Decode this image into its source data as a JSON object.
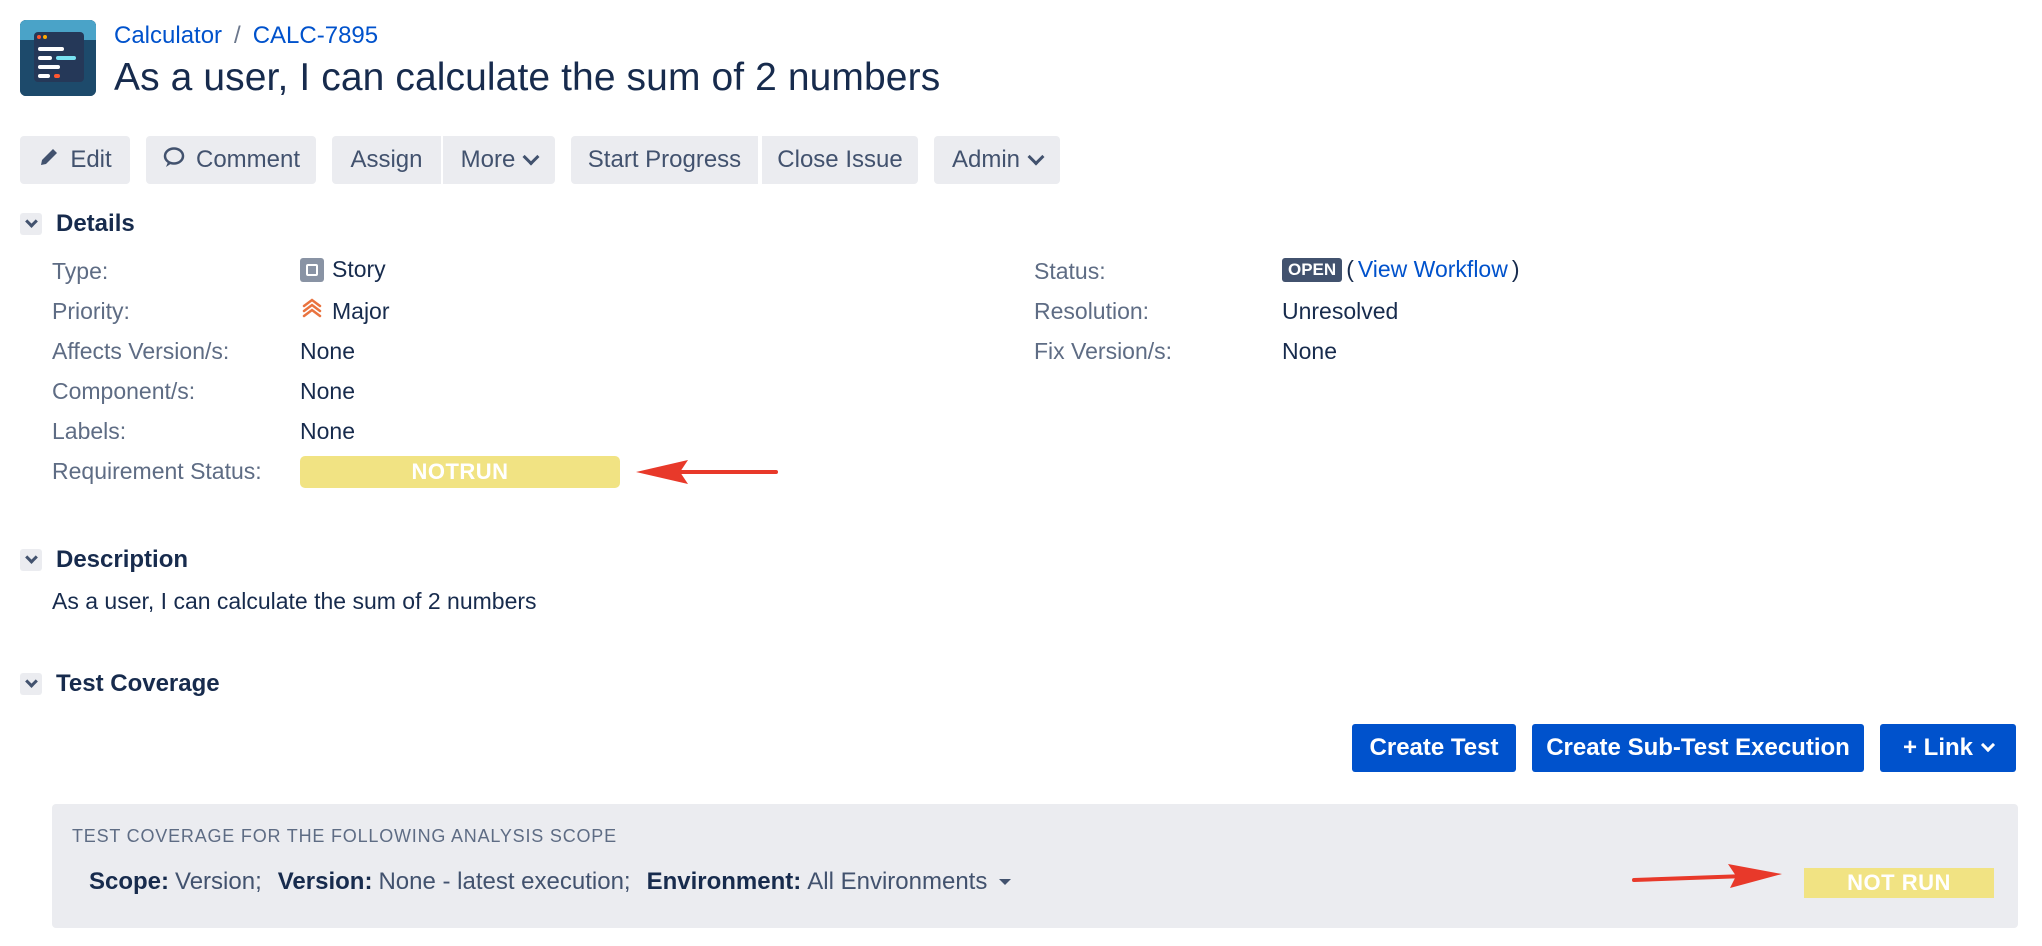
{
  "breadcrumb": {
    "project": "Calculator",
    "issue_key": "CALC-7895"
  },
  "issue": {
    "title": "As a user, I can calculate the sum of 2 numbers"
  },
  "toolbar": {
    "edit": "Edit",
    "comment": "Comment",
    "assign": "Assign",
    "more": "More",
    "start_progress": "Start Progress",
    "close_issue": "Close Issue",
    "admin": "Admin"
  },
  "details": {
    "heading": "Details",
    "type_label": "Type:",
    "type_value": "Story",
    "priority_label": "Priority:",
    "priority_value": "Major",
    "affects_label": "Affects Version/s:",
    "affects_value": "None",
    "components_label": "Component/s:",
    "components_value": "None",
    "labels_label": "Labels:",
    "labels_value": "None",
    "req_status_label": "Requirement Status:",
    "req_status_value": "NOTRUN",
    "status_label": "Status:",
    "status_value": "OPEN",
    "view_workflow": "View Workflow",
    "paren_open": "(",
    "paren_close": ")",
    "resolution_label": "Resolution:",
    "resolution_value": "Unresolved",
    "fix_label": "Fix Version/s:",
    "fix_value": "None"
  },
  "description": {
    "heading": "Description",
    "text": "As a user, I can calculate the sum of 2 numbers"
  },
  "test_coverage": {
    "heading": "Test Coverage",
    "create_test": "Create Test",
    "create_sub_test_execution": "Create Sub-Test Execution",
    "link": "+ Link",
    "panel_title": "TEST COVERAGE FOR THE FOLLOWING ANALYSIS SCOPE",
    "scope_label": "Scope:",
    "scope_value": "Version;",
    "version_label": "Version:",
    "version_value": "None - latest execution;",
    "environment_label": "Environment:",
    "environment_value": "All Environments",
    "status": "NOT RUN"
  },
  "colors": {
    "primary": "#0052cc",
    "notrun": "#f1e383",
    "arrow": "#e8392a",
    "priority": "#e9733f"
  }
}
